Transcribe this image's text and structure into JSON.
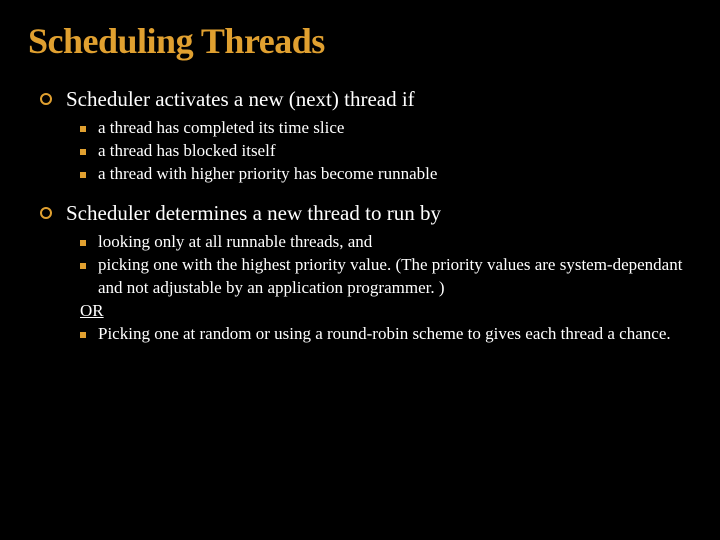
{
  "title": "Scheduling Threads",
  "section1": {
    "heading": "Scheduler activates a new (next) thread if",
    "items": [
      "a thread has completed its time slice",
      "a thread has blocked itself",
      "a thread with higher priority has become runnable"
    ]
  },
  "section2": {
    "heading": "Scheduler determines a new thread to run by",
    "items_a": [
      "looking only at all runnable threads, and",
      "picking one with the highest priority value. (The priority values are system-dependant and not adjustable by an application programmer. )"
    ],
    "or": "OR",
    "items_b": [
      "Picking one at random or using a round-robin scheme to gives each thread a chance."
    ]
  }
}
